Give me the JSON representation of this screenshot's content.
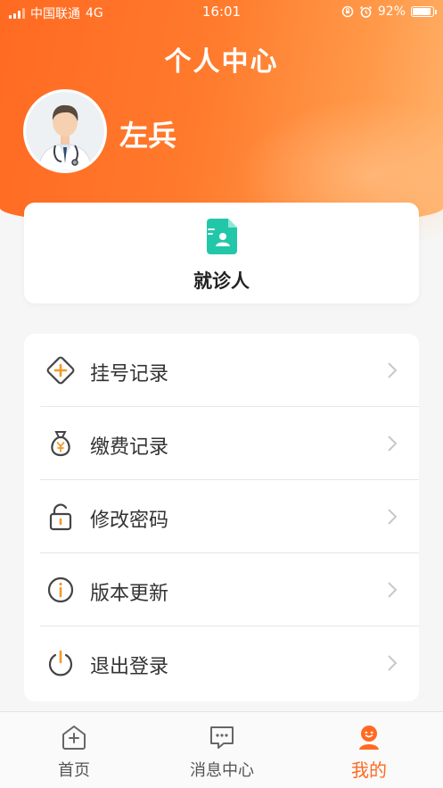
{
  "status_bar": {
    "carrier": "中国联通",
    "network": "4G",
    "time": "16:01",
    "battery": "92%",
    "battery_level": 0.92
  },
  "header": {
    "title": "个人中心"
  },
  "user": {
    "name": "左兵"
  },
  "patient_card": {
    "label": "就诊人"
  },
  "menu": {
    "items": [
      {
        "label": "挂号记录",
        "icon": "register-plus-icon"
      },
      {
        "label": "缴费记录",
        "icon": "money-bag-icon"
      },
      {
        "label": "修改密码",
        "icon": "lock-icon"
      },
      {
        "label": "版本更新",
        "icon": "info-icon"
      },
      {
        "label": "退出登录",
        "icon": "power-icon"
      }
    ]
  },
  "tabbar": {
    "tabs": [
      {
        "label": "首页",
        "icon": "home-plus-icon"
      },
      {
        "label": "消息中心",
        "icon": "message-icon"
      },
      {
        "label": "我的",
        "icon": "profile-icon",
        "active": true
      }
    ]
  },
  "colors": {
    "accent": "#ff6a22",
    "patient_icon": "#22c7a9"
  }
}
